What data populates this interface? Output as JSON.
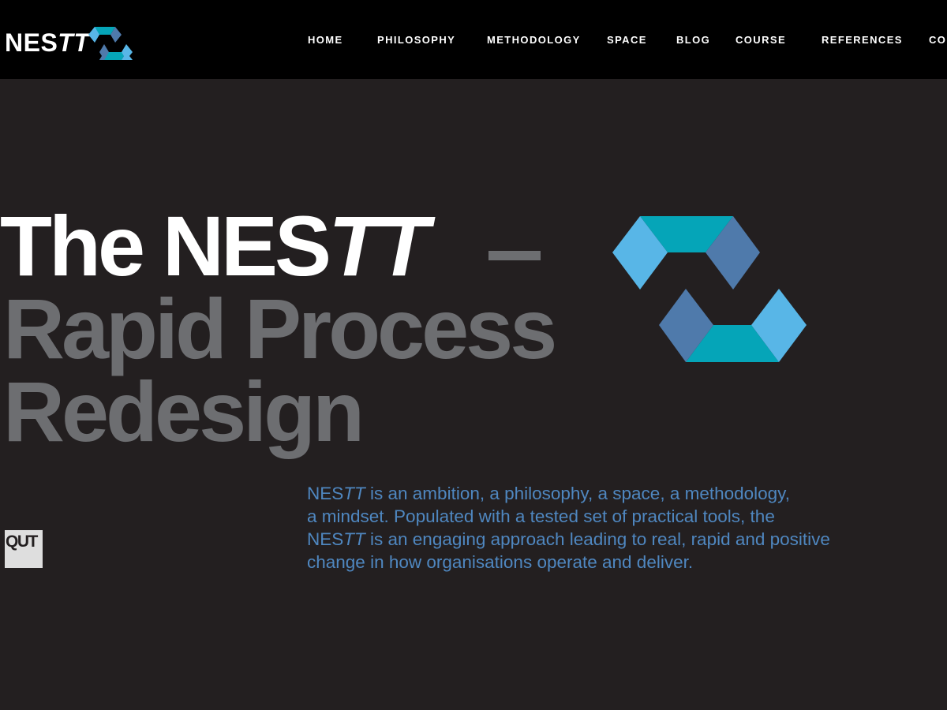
{
  "header": {
    "brand_prefix": "NES",
    "brand_suffix": "TT",
    "logo_icon": "nestt-chevron-logo-icon"
  },
  "nav": {
    "items": [
      {
        "label": "HOME"
      },
      {
        "label": "PHILOSOPHY"
      },
      {
        "label": "METHODOLOGY"
      },
      {
        "label": "SPACE"
      },
      {
        "label": "BLOG"
      },
      {
        "label": "COURSE"
      },
      {
        "label": "REFERENCES"
      },
      {
        "label": "CO"
      }
    ]
  },
  "hero": {
    "title_start": "The NES",
    "title_italic": "TT",
    "title_line2": "Rapid Process",
    "title_line3": "Redesign"
  },
  "intro": {
    "brand_prefix": "NES",
    "brand_suffix": "TT",
    "sentence1_rest": " is an ambition, a philosophy, a space, a methodology,",
    "line2": "a mindset. Populated with a tested set of practical tools, the",
    "sentence2_rest": " is an engaging approach leading to real, rapid and positive",
    "line4": "change in how organisations operate and deliver."
  },
  "footer": {
    "qut_logo_text": "QUT"
  },
  "colors": {
    "background": "#231f20",
    "topbar": "#000000",
    "accent_teal": "#05a5b8",
    "accent_light_blue": "#58b6e7",
    "accent_steel_blue": "#4f7aab",
    "hero_gray": "#6d6e71",
    "intro_text": "#4f87c0"
  }
}
